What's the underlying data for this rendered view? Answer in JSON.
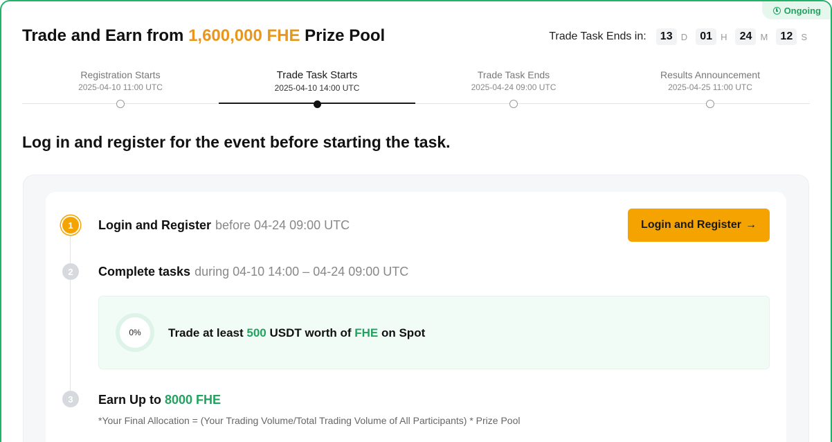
{
  "status": {
    "label": "Ongoing"
  },
  "header": {
    "title_prefix": "Trade and Earn from ",
    "title_accent": "1,600,000 FHE",
    "title_suffix": " Prize Pool"
  },
  "countdown": {
    "label": "Trade Task Ends in:",
    "days": "13",
    "days_unit": "D",
    "hours": "01",
    "hours_unit": "H",
    "minutes": "24",
    "minutes_unit": "M",
    "seconds": "12",
    "seconds_unit": "S"
  },
  "timeline": [
    {
      "title": "Registration Starts",
      "date": "2025-04-10 11:00 UTC"
    },
    {
      "title": "Trade Task Starts",
      "date": "2025-04-10 14:00 UTC"
    },
    {
      "title": "Trade Task Ends",
      "date": "2025-04-24 09:00 UTC"
    },
    {
      "title": "Results Announcement",
      "date": "2025-04-25 11:00 UTC"
    }
  ],
  "subheading": "Log in and register for the event before starting the task.",
  "steps": [
    {
      "num": "1",
      "title": "Login and Register",
      "sub": "before 04-24 09:00 UTC"
    },
    {
      "num": "2",
      "title": "Complete tasks",
      "sub": "during 04-10 14:00 – 04-24 09:00 UTC"
    },
    {
      "num": "3",
      "title_prefix": "Earn Up to ",
      "title_accent": "8000 FHE"
    }
  ],
  "login_button": {
    "label": "Login and Register",
    "arrow": "→"
  },
  "task": {
    "progress": "0%",
    "text_1": "Trade at least ",
    "amount": "500",
    "text_2": " USDT worth of ",
    "token": "FHE",
    "text_3": " on Spot"
  },
  "formula": "*Your Final Allocation = (Your Trading Volume/Total Trading Volume of All Participants) * Prize Pool",
  "colors": {
    "accent": "#f5a300",
    "green": "#21a35f",
    "title_accent": "#e8961e"
  }
}
